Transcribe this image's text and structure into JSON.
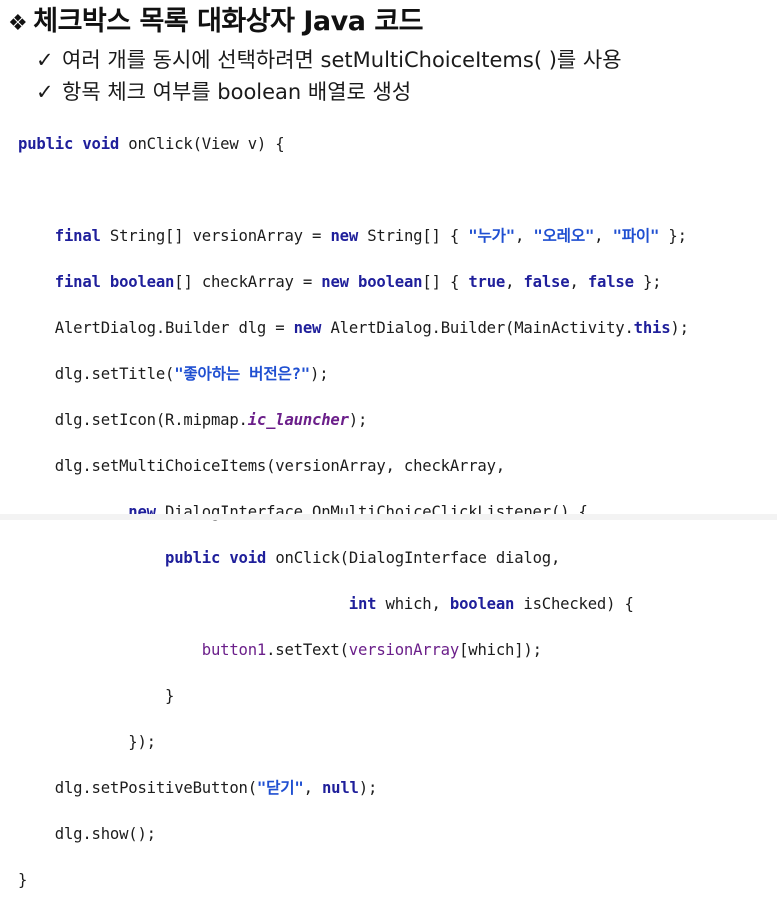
{
  "slide": {
    "title": "체크박스 목록 대화상자 Java 코드",
    "bullets": [
      "여러 개를 동시에 선택하려면 setMultiChoiceItems( )를 사용",
      "항목 체크 여부를 boolean 배열로 생성"
    ]
  },
  "code": {
    "l1": {
      "kw1": "public",
      "kw2": "void",
      "rest": " onClick(View v) {"
    },
    "l2": {
      "kw1": "final",
      "t1": " String[] versionArray = ",
      "kw2": "new",
      "t2": " String[] { ",
      "s1": "\"누가\"",
      "t3": ", ",
      "s2": "\"오레오\"",
      "t4": ", ",
      "s3": "\"파이\"",
      "t5": " };"
    },
    "l3": {
      "kw1": "final",
      "kw2": "boolean",
      "t1": "[] checkArray = ",
      "kw3": "new",
      "kw4": "boolean",
      "t2": "[] { ",
      "kw5": "true",
      "t3": ", ",
      "kw6": "false",
      "t4": ", ",
      "kw7": "false",
      "t5": " };"
    },
    "l4": {
      "t1": "AlertDialog.Builder dlg = ",
      "kw1": "new",
      "t2": " AlertDialog.Builder(MainActivity.",
      "kw2": "this",
      "t3": ");"
    },
    "l5": {
      "t1": "dlg.setTitle(",
      "s1": "\"좋아하는 버전은?\"",
      "t2": ");"
    },
    "l6": {
      "t1": "dlg.setIcon(R.mipmap.",
      "it1": "ic_launcher",
      "t2": ");"
    },
    "l7": {
      "t1": "dlg.setMultiChoiceItems(versionArray, checkArray,"
    },
    "l8": {
      "kw1": "new",
      "t1": " DialogInterface.OnMultiChoiceClickListener() {"
    },
    "l9": {
      "kw1": "public",
      "kw2": "void",
      "t1": " onClick(DialogInterface dialog,"
    },
    "l10": {
      "kw1": "int",
      "t1": " which, ",
      "kw2": "boolean",
      "t2": " isChecked) {"
    },
    "l11": {
      "f1": "button1",
      "t1": ".setText(",
      "f2": "versionArray",
      "t2": "[which]);"
    },
    "l12": {
      "t1": "}"
    },
    "l13": {
      "t1": "});"
    },
    "l14": {
      "t1": "dlg.setPositiveButton(",
      "s1": "\"닫기\"",
      "t2": ", ",
      "kw1": "null",
      "t3": ");"
    },
    "l15": {
      "t1": "dlg.show();"
    },
    "l16": {
      "t1": "}"
    }
  }
}
